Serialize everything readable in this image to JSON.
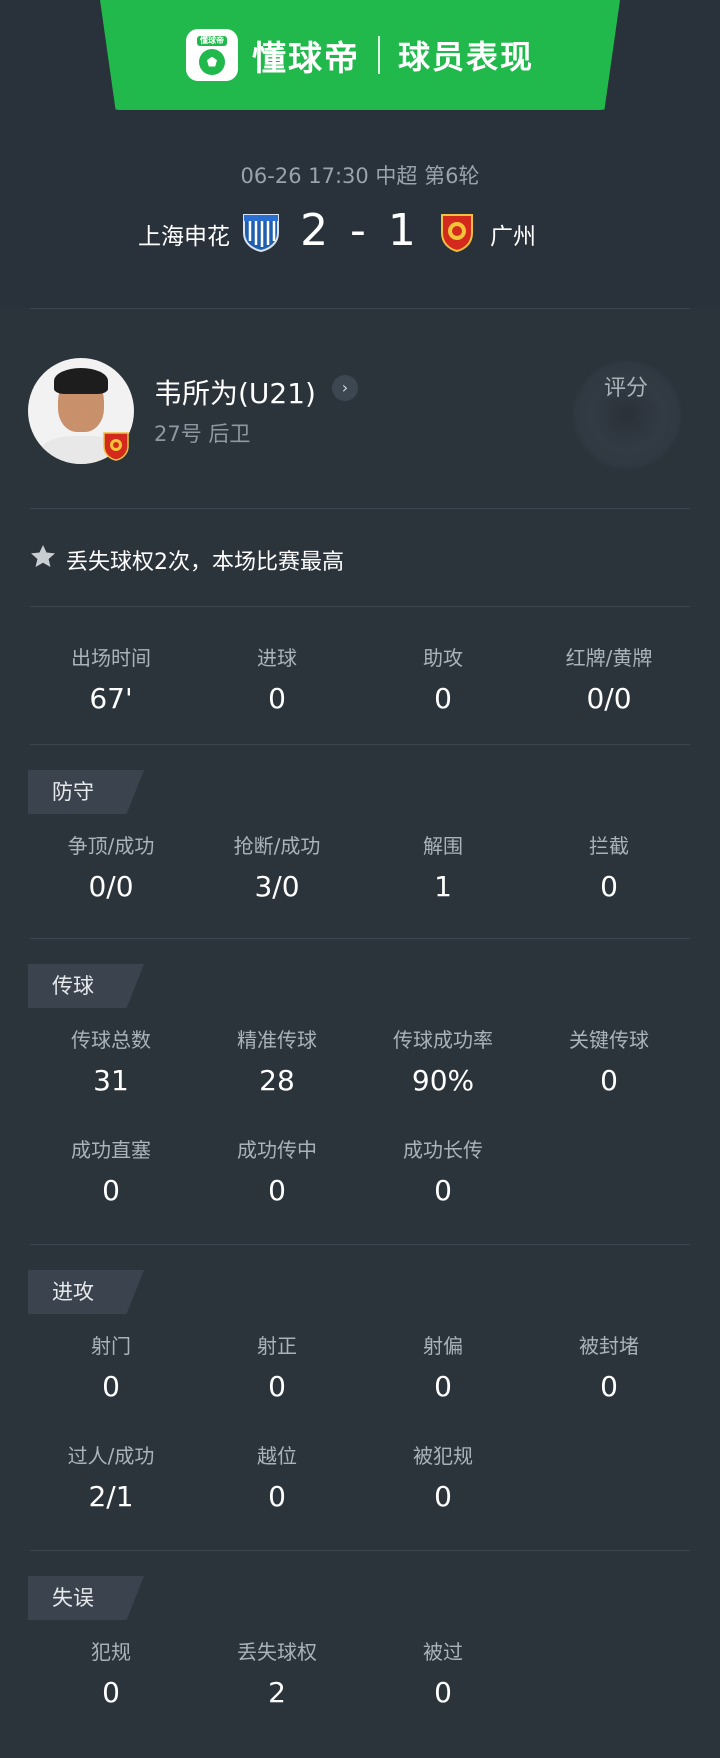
{
  "header": {
    "brand": "懂球帝",
    "logo_text": "懂球帝",
    "title": "球员表现",
    "brand_color": "#21b94c"
  },
  "match": {
    "meta": "06-26 17:30 中超 第6轮",
    "home_team": "上海申花",
    "away_team": "广州",
    "score": "2 - 1",
    "home_crest_icon": "shanghai-shenhua-crest-icon",
    "away_crest_icon": "guangzhou-crest-icon"
  },
  "player": {
    "name": "韦所为(U21)",
    "subtitle": "27号 后卫",
    "rating_label": "评分",
    "chevron": "›"
  },
  "highlight": {
    "icon": "star-icon",
    "text": "丢失球权2次，本场比赛最高"
  },
  "summary": [
    {
      "label": "出场时间",
      "value": "67'"
    },
    {
      "label": "进球",
      "value": "0"
    },
    {
      "label": "助攻",
      "value": "0"
    },
    {
      "label": "红牌/黄牌",
      "value": "0/0"
    }
  ],
  "sections": {
    "defense": {
      "title": "防守",
      "stats": [
        {
          "label": "争顶/成功",
          "value": "0/0"
        },
        {
          "label": "抢断/成功",
          "value": "3/0"
        },
        {
          "label": "解围",
          "value": "1"
        },
        {
          "label": "拦截",
          "value": "0"
        }
      ]
    },
    "passing": {
      "title": "传球",
      "stats": [
        {
          "label": "传球总数",
          "value": "31"
        },
        {
          "label": "精准传球",
          "value": "28"
        },
        {
          "label": "传球成功率",
          "value": "90%"
        },
        {
          "label": "关键传球",
          "value": "0"
        },
        {
          "label": "成功直塞",
          "value": "0"
        },
        {
          "label": "成功传中",
          "value": "0"
        },
        {
          "label": "成功长传",
          "value": "0"
        }
      ]
    },
    "attack": {
      "title": "进攻",
      "stats": [
        {
          "label": "射门",
          "value": "0"
        },
        {
          "label": "射正",
          "value": "0"
        },
        {
          "label": "射偏",
          "value": "0"
        },
        {
          "label": "被封堵",
          "value": "0"
        },
        {
          "label": "过人/成功",
          "value": "2/1"
        },
        {
          "label": "越位",
          "value": "0"
        },
        {
          "label": "被犯规",
          "value": "0"
        }
      ]
    },
    "errors": {
      "title": "失误",
      "stats": [
        {
          "label": "犯规",
          "value": "0"
        },
        {
          "label": "丢失球权",
          "value": "2"
        },
        {
          "label": "被过",
          "value": "0"
        }
      ]
    }
  }
}
